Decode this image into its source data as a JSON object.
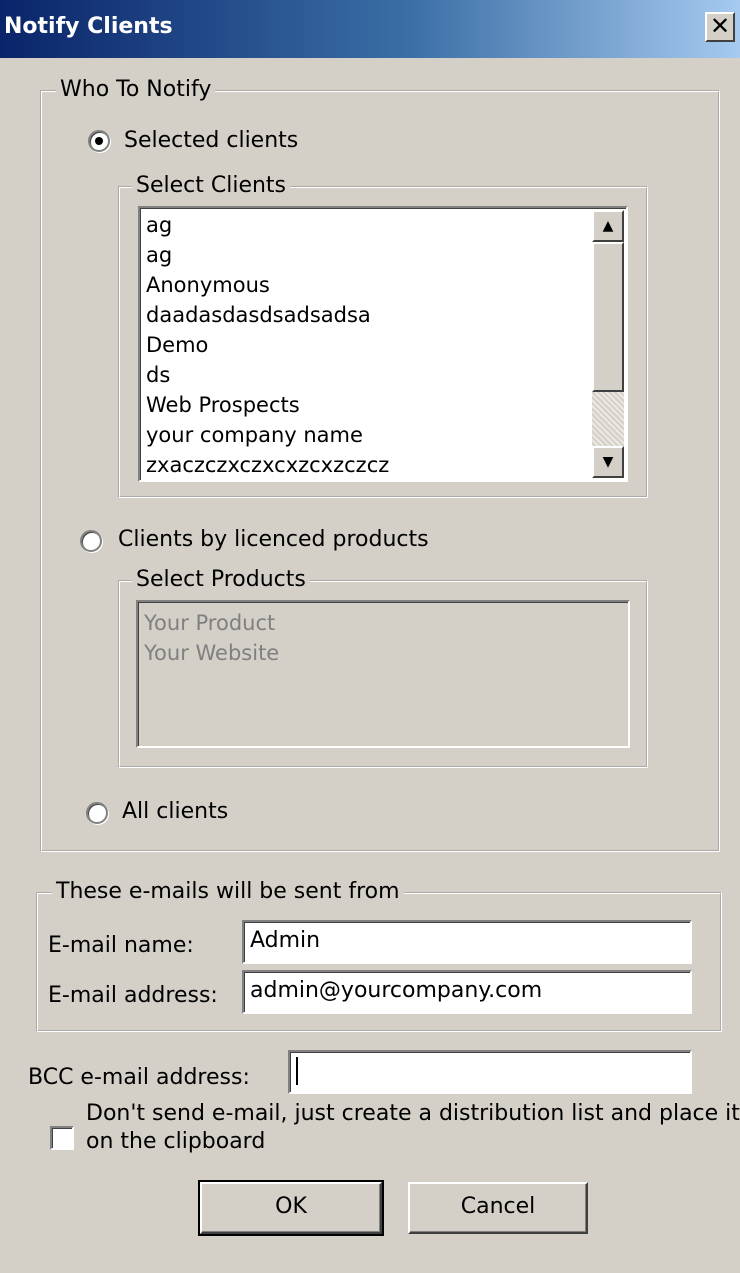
{
  "window": {
    "title": "Notify Clients",
    "close_glyph": "✕"
  },
  "who_to_notify": {
    "legend": "Who To Notify",
    "selected_clients_label": "Selected clients",
    "select_clients_legend": "Select Clients",
    "clients": [
      "ag",
      "ag",
      "Anonymous",
      "daadasdasdsadsadsa",
      "Demo",
      "ds",
      "Web Prospects",
      "your company name",
      "zxaczczxczxcxzcxzczcz"
    ],
    "by_products_label": "Clients by licenced products",
    "select_products_legend": "Select Products",
    "products": [
      "Your Product",
      "Your Website"
    ],
    "all_clients_label": "All clients",
    "selected_option": "Selected clients"
  },
  "sender": {
    "legend": "These e-mails will be sent from",
    "name_label": "E-mail name:",
    "name_value": "Admin",
    "address_label": "E-mail address:",
    "address_value": "admin@yourcompany.com"
  },
  "bcc": {
    "label": "BCC e-mail address:",
    "value": ""
  },
  "distribution": {
    "line1": "Don't send e-mail, just create a distribution list and place it",
    "line2": "on the clipboard",
    "checked": false
  },
  "buttons": {
    "ok": "OK",
    "cancel": "Cancel"
  },
  "icons": {
    "scroll_up": "triangle-up-icon",
    "scroll_down": "triangle-down-icon"
  },
  "colors": {
    "title_start": "#0a246a",
    "title_end": "#a6caf0",
    "face": "#d4d0c8"
  }
}
